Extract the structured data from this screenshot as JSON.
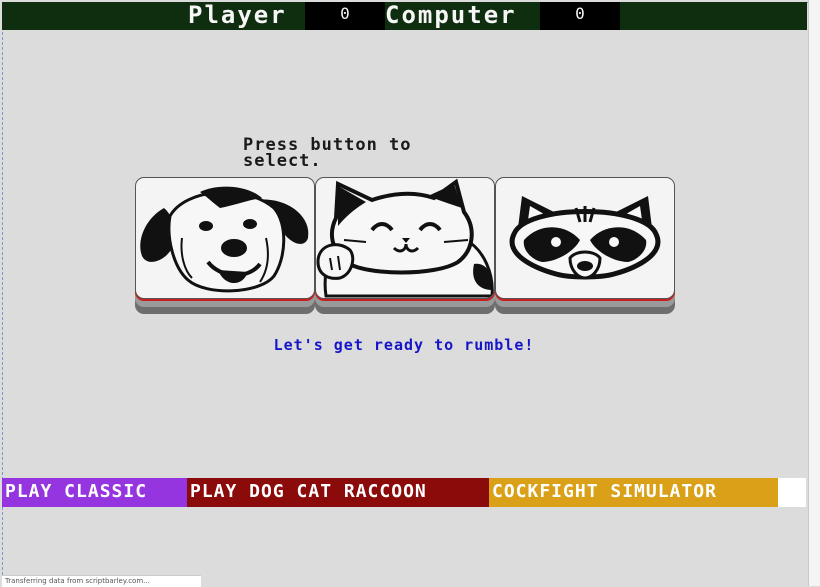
{
  "scoreboard": {
    "player_label": "Player",
    "player_score": "0",
    "computer_label": "Computer",
    "computer_score": "0"
  },
  "prompt": "Press button to select.",
  "choices": [
    {
      "icon": "dog-icon"
    },
    {
      "icon": "cat-icon"
    },
    {
      "icon": "raccoon-icon"
    }
  ],
  "tagline": "Let's get ready to rumble!",
  "modes": [
    {
      "label": "PLAY CLASSIC",
      "color": "#9535e0"
    },
    {
      "label": "PLAY DOG CAT RACCOON",
      "color": "#8b0a0a"
    },
    {
      "label": "COCKFIGHT SIMULATOR",
      "color": "#d9a018"
    }
  ],
  "status_bar": "Transferring data from scriptbarley.com..."
}
